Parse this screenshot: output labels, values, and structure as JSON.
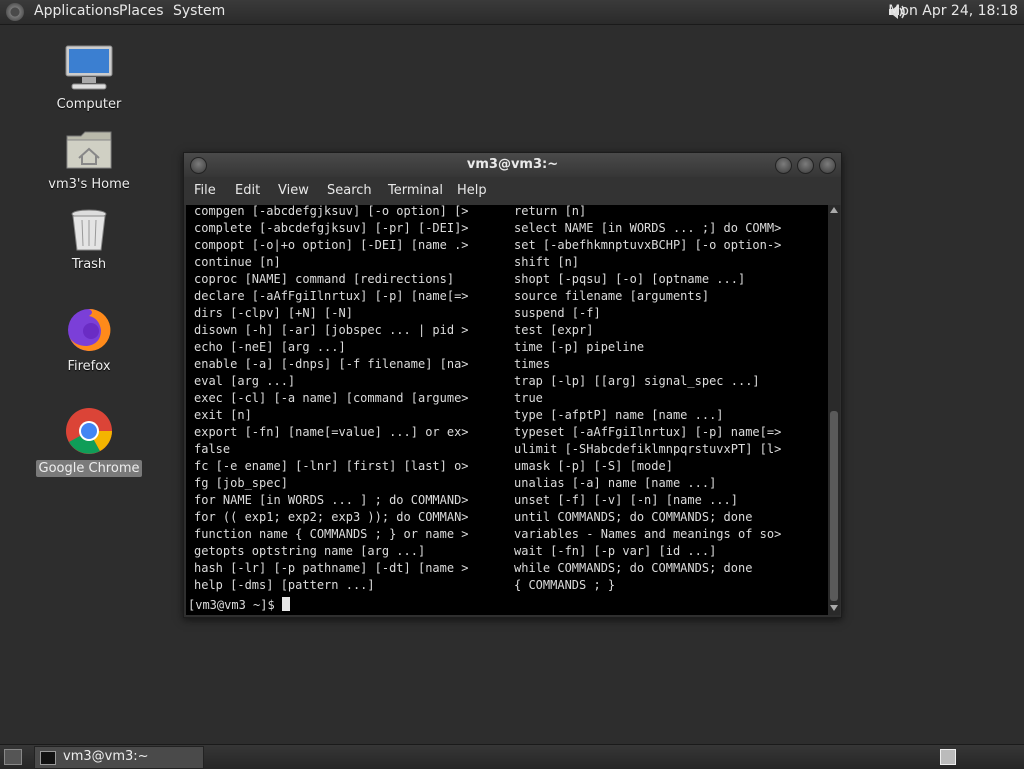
{
  "top_panel": {
    "applications": "Applications",
    "places": "Places",
    "system": "System",
    "clock": "Mon Apr 24, 18:18"
  },
  "desktop": {
    "icons": [
      {
        "label": "Computer"
      },
      {
        "label": "vm3's Home"
      },
      {
        "label": "Trash"
      },
      {
        "label": "Firefox"
      },
      {
        "label": "Google Chrome"
      }
    ]
  },
  "terminal": {
    "title": "vm3@vm3:~",
    "menu": [
      "File",
      "Edit",
      "View",
      "Search",
      "Terminal",
      "Help"
    ],
    "left_column": [
      "compgen [-abcdefgjksuv] [-o option] [>",
      "complete [-abcdefgjksuv] [-pr] [-DEI]>",
      "compopt [-o|+o option] [-DEI] [name .>",
      "continue [n]",
      "coproc [NAME] command [redirections]",
      "declare [-aAfFgiIlnrtux] [-p] [name[=>",
      "dirs [-clpv] [+N] [-N]",
      "disown [-h] [-ar] [jobspec ... | pid >",
      "echo [-neE] [arg ...]",
      "enable [-a] [-dnps] [-f filename] [na>",
      "eval [arg ...]",
      "exec [-cl] [-a name] [command [argume>",
      "exit [n]",
      "export [-fn] [name[=value] ...] or ex>",
      "false",
      "fc [-e ename] [-lnr] [first] [last] o>",
      "fg [job_spec]",
      "for NAME [in WORDS ... ] ; do COMMAND>",
      "for (( exp1; exp2; exp3 )); do COMMAN>",
      "function name { COMMANDS ; } or name >",
      "getopts optstring name [arg ...]",
      "hash [-lr] [-p pathname] [-dt] [name >",
      "help [-dms] [pattern ...]"
    ],
    "right_column": [
      "return [n]",
      "select NAME [in WORDS ... ;] do COMM>",
      "set [-abefhkmnptuvxBCHP] [-o option->",
      "shift [n]",
      "shopt [-pqsu] [-o] [optname ...]",
      "source filename [arguments]",
      "suspend [-f]",
      "test [expr]",
      "time [-p] pipeline",
      "times",
      "trap [-lp] [[arg] signal_spec ...]",
      "true",
      "type [-afptP] name [name ...]",
      "typeset [-aAfFgiIlnrtux] [-p] name[=>",
      "ulimit [-SHabcdefiklmnpqrstuvxPT] [l>",
      "umask [-p] [-S] [mode]",
      "unalias [-a] name [name ...]",
      "unset [-f] [-v] [-n] [name ...]",
      "until COMMANDS; do COMMANDS; done",
      "variables - Names and meanings of so>",
      "wait [-fn] [-p var] [id ...]",
      "while COMMANDS; do COMMANDS; done",
      "{ COMMANDS ; }"
    ],
    "prompt": "[vm3@vm3 ~]$ "
  },
  "bottom_panel": {
    "taskbar_label": "vm3@vm3:~"
  }
}
